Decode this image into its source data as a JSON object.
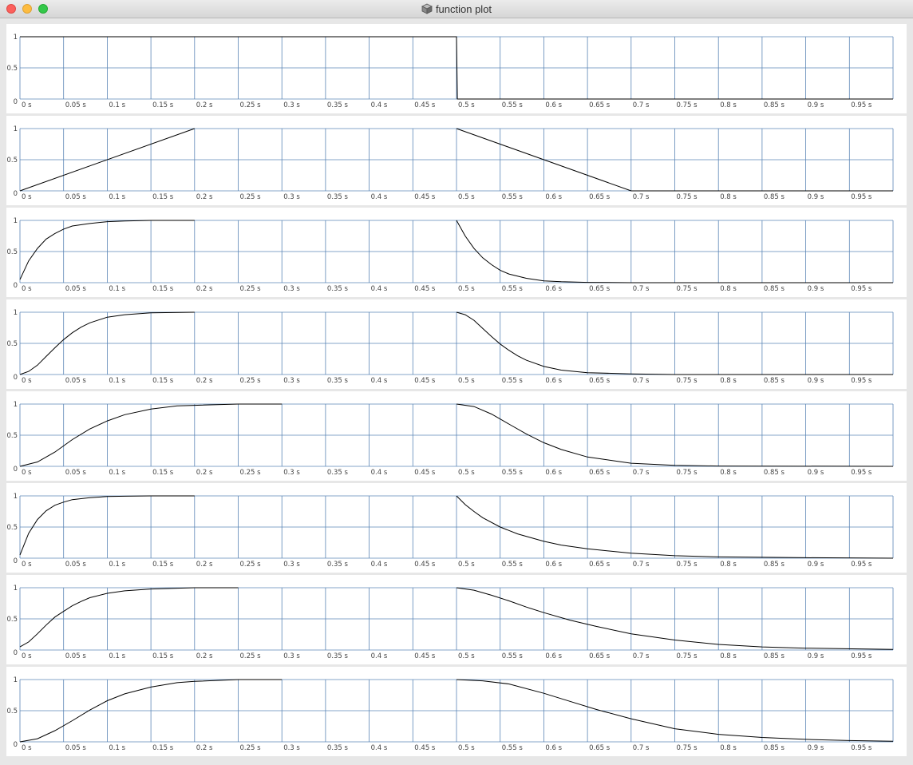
{
  "window": {
    "title": "function plot",
    "title_icon": "cube-app-icon"
  },
  "colors": {
    "grid": "#5b86b6",
    "curve": "#000000",
    "panel": "#ffffff",
    "background": "#e7e7e7"
  },
  "chart_data": [
    {
      "type": "line",
      "xlim": [
        0,
        1
      ],
      "ylim": [
        0,
        1
      ],
      "x_ticks": [
        "0 s",
        "0.05 s",
        "0.1 s",
        "0.15 s",
        "0.2 s",
        "0.25 s",
        "0.3 s",
        "0.35 s",
        "0.4 s",
        "0.45 s",
        "0.5 s",
        "0.55 s",
        "0.6 s",
        "0.65 s",
        "0.7 s",
        "0.75 s",
        "0.8 s",
        "0.85 s",
        "0.9 s",
        "0.95 s"
      ],
      "y_ticks": [
        "0",
        "0.5",
        "1"
      ],
      "grid": true,
      "series": [
        {
          "x": [
            0,
            0.4999,
            0.5,
            0.501,
            1.0
          ],
          "y": [
            1,
            1,
            1,
            0,
            0
          ]
        }
      ]
    },
    {
      "type": "line",
      "xlim": [
        0,
        1
      ],
      "ylim": [
        0,
        1
      ],
      "x_ticks": [
        "0 s",
        "0.05 s",
        "0.1 s",
        "0.15 s",
        "0.2 s",
        "0.25 s",
        "0.3 s",
        "0.35 s",
        "0.4 s",
        "0.45 s",
        "0.5 s",
        "0.55 s",
        "0.6 s",
        "0.65 s",
        "0.7 s",
        "0.75 s",
        "0.8 s",
        "0.85 s",
        "0.9 s",
        "0.95 s"
      ],
      "y_ticks": [
        "0",
        "0.5",
        "1"
      ],
      "grid": true,
      "series": [
        {
          "x": [
            0,
            0.2,
            0.2,
            0.5,
            0.5,
            0.7,
            1.0
          ],
          "y": [
            0,
            1,
            null,
            null,
            1,
            0,
            0
          ]
        }
      ]
    },
    {
      "type": "line",
      "xlim": [
        0,
        1
      ],
      "ylim": [
        0,
        1
      ],
      "x_ticks": [
        "0 s",
        "0.05 s",
        "0.1 s",
        "0.15 s",
        "0.2 s",
        "0.25 s",
        "0.3 s",
        "0.35 s",
        "0.4 s",
        "0.45 s",
        "0.5 s",
        "0.55 s",
        "0.6 s",
        "0.65 s",
        "0.7 s",
        "0.75 s",
        "0.8 s",
        "0.85 s",
        "0.9 s",
        "0.95 s"
      ],
      "y_ticks": [
        "0",
        "0.5",
        "1"
      ],
      "grid": true,
      "series": [
        {
          "x": [
            0,
            0.01,
            0.02,
            0.03,
            0.04,
            0.05,
            0.06,
            0.08,
            0.1,
            0.12,
            0.15,
            0.2,
            0.2,
            0.5,
            0.5,
            0.51,
            0.52,
            0.53,
            0.54,
            0.55,
            0.56,
            0.58,
            0.6,
            0.62,
            0.65,
            0.7,
            1.0
          ],
          "y": [
            0.05,
            0.35,
            0.55,
            0.7,
            0.79,
            0.86,
            0.91,
            0.95,
            0.98,
            0.99,
            1.0,
            1.0,
            null,
            null,
            1.0,
            0.75,
            0.55,
            0.4,
            0.29,
            0.2,
            0.14,
            0.07,
            0.03,
            0.015,
            0.005,
            0.0,
            0.0
          ]
        }
      ]
    },
    {
      "type": "line",
      "xlim": [
        0,
        1
      ],
      "ylim": [
        0,
        1
      ],
      "x_ticks": [
        "0 s",
        "0.05 s",
        "0.1 s",
        "0.15 s",
        "0.2 s",
        "0.25 s",
        "0.3 s",
        "0.35 s",
        "0.4 s",
        "0.45 s",
        "0.5 s",
        "0.55 s",
        "0.6 s",
        "0.65 s",
        "0.7 s",
        "0.75 s",
        "0.8 s",
        "0.85 s",
        "0.9 s",
        "0.95 s"
      ],
      "y_ticks": [
        "0",
        "0.5",
        "1"
      ],
      "grid": true,
      "series": [
        {
          "x": [
            0,
            0.01,
            0.02,
            0.03,
            0.04,
            0.05,
            0.06,
            0.07,
            0.08,
            0.1,
            0.12,
            0.15,
            0.2,
            0.2,
            0.5,
            0.5,
            0.51,
            0.52,
            0.53,
            0.54,
            0.55,
            0.56,
            0.57,
            0.58,
            0.6,
            0.62,
            0.65,
            0.7,
            0.75,
            1.0
          ],
          "y": [
            0.0,
            0.05,
            0.15,
            0.29,
            0.43,
            0.56,
            0.67,
            0.76,
            0.83,
            0.92,
            0.96,
            0.99,
            1.0,
            null,
            null,
            1.0,
            0.96,
            0.87,
            0.74,
            0.61,
            0.49,
            0.39,
            0.3,
            0.23,
            0.13,
            0.07,
            0.03,
            0.01,
            0.0,
            0.0
          ]
        }
      ]
    },
    {
      "type": "line",
      "xlim": [
        0,
        1
      ],
      "ylim": [
        0,
        1
      ],
      "x_ticks": [
        "0 s",
        "0.05 s",
        "0.1 s",
        "0.15 s",
        "0.2 s",
        "0.25 s",
        "0.3 s",
        "0.35 s",
        "0.4 s",
        "0.45 s",
        "0.5 s",
        "0.55 s",
        "0.6 s",
        "0.65 s",
        "0.7 s",
        "0.75 s",
        "0.8 s",
        "0.85 s",
        "0.9 s",
        "0.95 s"
      ],
      "y_ticks": [
        "0",
        "0.5",
        "1"
      ],
      "grid": true,
      "series": [
        {
          "x": [
            0,
            0.02,
            0.04,
            0.06,
            0.08,
            0.1,
            0.12,
            0.15,
            0.18,
            0.2,
            0.25,
            0.3,
            0.3,
            0.5,
            0.5,
            0.52,
            0.54,
            0.56,
            0.58,
            0.6,
            0.62,
            0.65,
            0.7,
            0.75,
            0.8,
            1.0
          ],
          "y": [
            0.0,
            0.07,
            0.23,
            0.43,
            0.6,
            0.73,
            0.83,
            0.92,
            0.97,
            0.98,
            1.0,
            1.0,
            null,
            null,
            1.0,
            0.96,
            0.84,
            0.68,
            0.52,
            0.38,
            0.27,
            0.15,
            0.05,
            0.015,
            0.005,
            0.0
          ]
        }
      ]
    },
    {
      "type": "line",
      "xlim": [
        0,
        1
      ],
      "ylim": [
        0,
        1
      ],
      "x_ticks": [
        "0 s",
        "0.05 s",
        "0.1 s",
        "0.15 s",
        "0.2 s",
        "0.25 s",
        "0.3 s",
        "0.35 s",
        "0.4 s",
        "0.45 s",
        "0.5 s",
        "0.55 s",
        "0.6 s",
        "0.65 s",
        "0.7 s",
        "0.75 s",
        "0.8 s",
        "0.85 s",
        "0.9 s",
        "0.95 s"
      ],
      "y_ticks": [
        "0",
        "0.5",
        "1"
      ],
      "grid": true,
      "series": [
        {
          "x": [
            0,
            0.01,
            0.02,
            0.03,
            0.04,
            0.05,
            0.06,
            0.08,
            0.1,
            0.12,
            0.15,
            0.2,
            0.2,
            0.5,
            0.5,
            0.51,
            0.52,
            0.53,
            0.55,
            0.57,
            0.6,
            0.62,
            0.65,
            0.7,
            0.75,
            0.8,
            0.9,
            1.0
          ],
          "y": [
            0.05,
            0.4,
            0.62,
            0.76,
            0.85,
            0.9,
            0.94,
            0.97,
            0.99,
            0.995,
            1.0,
            1.0,
            null,
            null,
            1.0,
            0.86,
            0.75,
            0.65,
            0.5,
            0.39,
            0.27,
            0.21,
            0.15,
            0.08,
            0.04,
            0.02,
            0.008,
            0.0
          ]
        }
      ]
    },
    {
      "type": "line",
      "xlim": [
        0,
        1
      ],
      "ylim": [
        0,
        1
      ],
      "x_ticks": [
        "0 s",
        "0.05 s",
        "0.1 s",
        "0.15 s",
        "0.2 s",
        "0.25 s",
        "0.3 s",
        "0.35 s",
        "0.4 s",
        "0.45 s",
        "0.5 s",
        "0.55 s",
        "0.6 s",
        "0.65 s",
        "0.7 s",
        "0.75 s",
        "0.8 s",
        "0.85 s",
        "0.9 s",
        "0.95 s"
      ],
      "y_ticks": [
        "0",
        "0.5",
        "1"
      ],
      "grid": true,
      "series": [
        {
          "x": [
            0,
            0.01,
            0.02,
            0.03,
            0.04,
            0.05,
            0.06,
            0.07,
            0.08,
            0.1,
            0.12,
            0.15,
            0.2,
            0.25,
            0.25,
            0.5,
            0.5,
            0.52,
            0.54,
            0.56,
            0.58,
            0.6,
            0.63,
            0.66,
            0.7,
            0.75,
            0.8,
            0.85,
            0.9,
            1.0
          ],
          "y": [
            0.05,
            0.13,
            0.26,
            0.4,
            0.53,
            0.62,
            0.71,
            0.78,
            0.84,
            0.91,
            0.95,
            0.98,
            1.0,
            1.0,
            null,
            null,
            1.0,
            0.96,
            0.88,
            0.79,
            0.69,
            0.6,
            0.48,
            0.38,
            0.26,
            0.16,
            0.09,
            0.05,
            0.03,
            0.01
          ]
        }
      ]
    },
    {
      "type": "line",
      "xlim": [
        0,
        1
      ],
      "ylim": [
        0,
        1
      ],
      "x_ticks": [
        "0 s",
        "0.05 s",
        "0.1 s",
        "0.15 s",
        "0.2 s",
        "0.25 s",
        "0.3 s",
        "0.35 s",
        "0.4 s",
        "0.45 s",
        "0.5 s",
        "0.55 s",
        "0.6 s",
        "0.65 s",
        "0.7 s",
        "0.75 s",
        "0.8 s",
        "0.85 s",
        "0.9 s",
        "0.95 s"
      ],
      "y_ticks": [
        "0",
        "0.5",
        "1"
      ],
      "grid": true,
      "series": [
        {
          "x": [
            0,
            0.02,
            0.04,
            0.06,
            0.08,
            0.1,
            0.12,
            0.15,
            0.18,
            0.2,
            0.25,
            0.3,
            0.3,
            0.5,
            0.5,
            0.53,
            0.56,
            0.6,
            0.63,
            0.66,
            0.7,
            0.75,
            0.8,
            0.85,
            0.9,
            0.95,
            1.0
          ],
          "y": [
            0.0,
            0.05,
            0.18,
            0.34,
            0.51,
            0.66,
            0.77,
            0.88,
            0.95,
            0.97,
            1.0,
            1.0,
            null,
            null,
            1.0,
            0.98,
            0.93,
            0.78,
            0.65,
            0.52,
            0.37,
            0.21,
            0.12,
            0.07,
            0.04,
            0.02,
            0.01
          ]
        }
      ]
    }
  ]
}
